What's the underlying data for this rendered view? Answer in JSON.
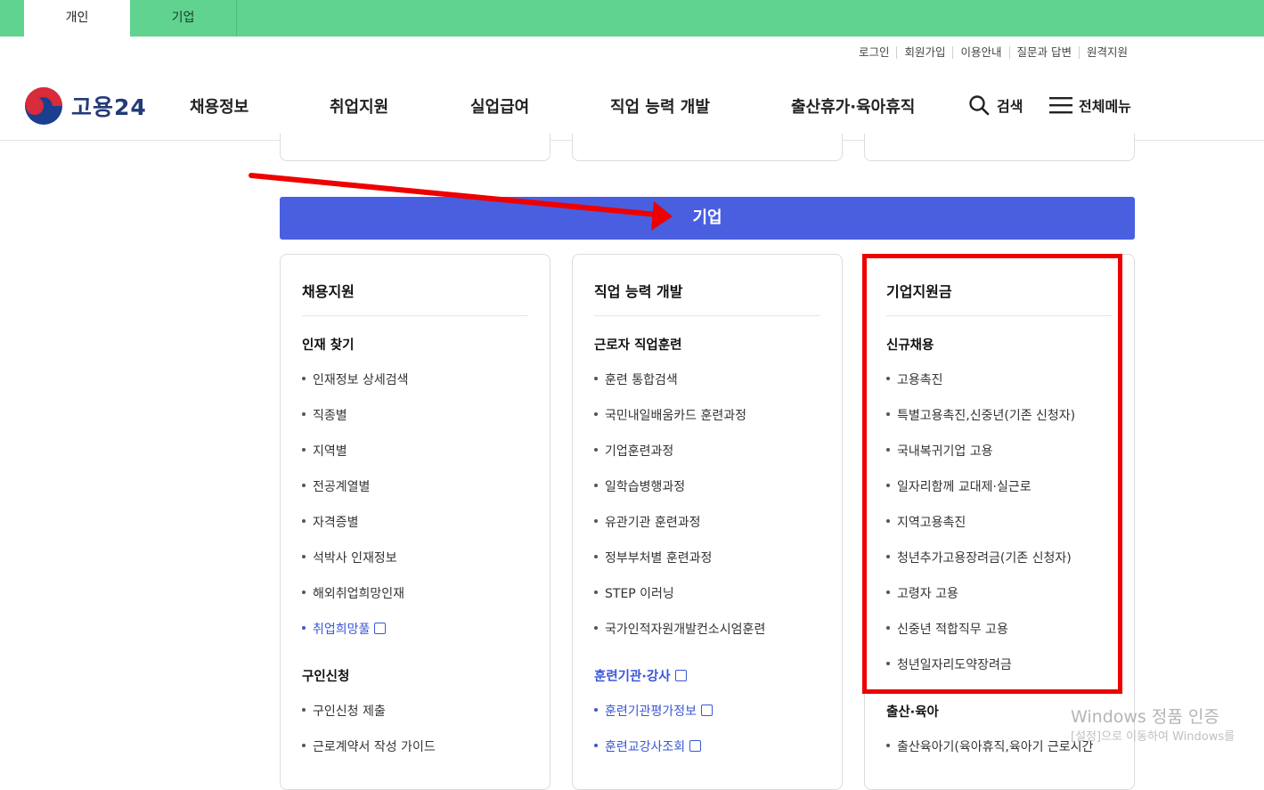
{
  "tabs": {
    "personal": "개인",
    "business": "기업"
  },
  "util_links": [
    "로그인",
    "회원가입",
    "이용안내",
    "질문과 답변",
    "원격지원"
  ],
  "logo_text": "고용24",
  "nav": [
    "채용정보",
    "취업지원",
    "실업급여",
    "직업 능력 개발",
    "출산휴가·육아휴직"
  ],
  "search_label": "검색",
  "allmenu_label": "전체메뉴",
  "banner": "기업",
  "card1": {
    "title": "채용지원",
    "sec1": "인재 찾기",
    "sec1_items": [
      "인재정보 상세검색",
      "직종별",
      "지역별",
      "전공계열별",
      "자격증별",
      "석박사 인재정보",
      "해외취업희망인재"
    ],
    "sec1_link": "취업희망풀",
    "sec2": "구인신청",
    "sec2_items": [
      "구인신청 제출",
      "근로계약서 작성 가이드"
    ]
  },
  "card2": {
    "title": "직업 능력 개발",
    "sec1": "근로자 직업훈련",
    "sec1_items": [
      "훈련 통합검색",
      "국민내일배움카드 훈련과정",
      "기업훈련과정",
      "일학습병행과정",
      "유관기관 훈련과정",
      "정부부처별 훈련과정",
      "STEP 이러닝",
      "국가인적자원개발컨소시엄훈련"
    ],
    "sec2": "훈련기관·강사",
    "sec2_links": [
      "훈련기관평가정보",
      "훈련교강사조회"
    ]
  },
  "card3": {
    "title": "기업지원금",
    "sec1": "신규채용",
    "sec1_items": [
      "고용촉진",
      "특별고용촉진,신중년(기존 신청자)",
      "국내복귀기업 고용",
      "일자리함께 교대제·실근로",
      "지역고용촉진",
      "청년추가고용장려금(기존 신청자)",
      "고령자 고용",
      "신중년 적합직무 고용",
      "청년일자리도약장려금"
    ],
    "sec2": "출산·육아",
    "sec2_items": [
      "출산육아기(육아휴직,육아기 근로시간"
    ]
  },
  "watermark": {
    "line1": "Windows 정품 인증",
    "line2": "[설정]으로 이동하여 Windows를"
  },
  "colors": {
    "topbar": "#5fd38f",
    "banner": "#4a5fe0",
    "highlight": "#ee0000",
    "link": "#3a57d6"
  }
}
